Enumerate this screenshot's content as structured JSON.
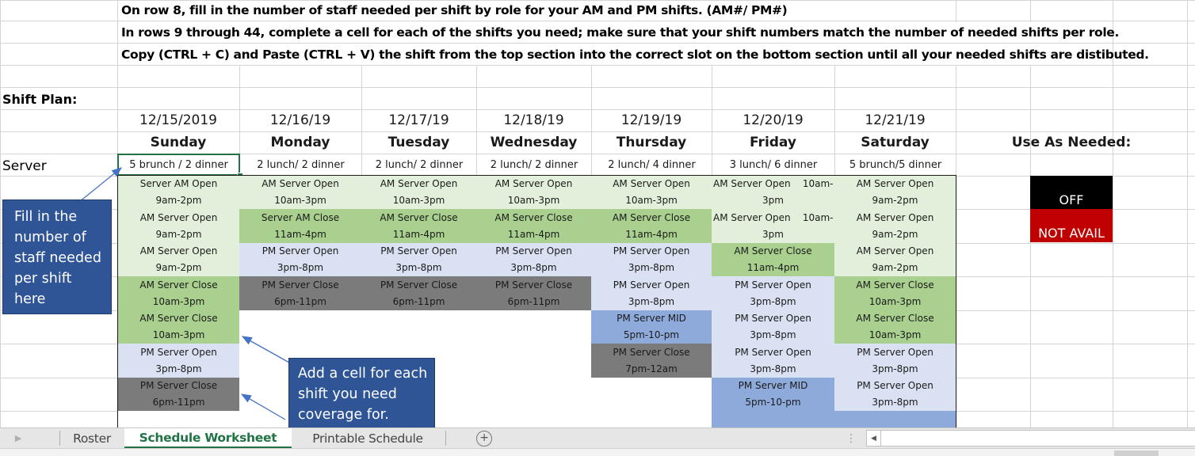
{
  "instructions": [
    "On row 8, fill in the number of staff needed per shift by role for your AM and PM shifts. (AM#/ PM#)",
    "In rows 9 through 44, complete a cell for each of the shifts you need; make sure that your shift numbers match the number of needed shifts per role.",
    "Copy (CTRL + C) and Paste (CTRL + V) the shift from the top section into the correct slot on the bottom section until all your needed shifts are distibuted."
  ],
  "shift_plan_label": "Shift Plan:",
  "role_label": "Server",
  "use_as_needed_label": "Use As Needed:",
  "colors": {
    "am_open": "#e2efda",
    "am_close": "#a9d08e",
    "pm_open": "#d9e1f2",
    "pm_mid": "#8eaadb",
    "pm_close": "#7b7b7b",
    "off": "#000000",
    "not_avail": "#c00000",
    "callout": "#2f5597",
    "active_tab": "#217346"
  },
  "days": [
    {
      "date": "12/15/2019",
      "day": "Sunday",
      "needed": "5 brunch / 2 dinner",
      "shifts": [
        {
          "name": "Server AM Open",
          "time": "9am-2pm",
          "type": "am_open"
        },
        {
          "name": "AM Server Open",
          "time": "9am-2pm",
          "type": "am_open"
        },
        {
          "name": "AM Server Open",
          "time": "9am-2pm",
          "type": "am_open"
        },
        {
          "name": "AM Server Close",
          "time": "10am-3pm",
          "type": "am_close"
        },
        {
          "name": "AM Server Close",
          "time": "10am-3pm",
          "type": "am_close"
        },
        {
          "name": "PM Server Open",
          "time": "3pm-8pm",
          "type": "pm_open"
        },
        {
          "name": "PM Server Close",
          "time": "6pm-11pm",
          "type": "pm_close"
        }
      ]
    },
    {
      "date": "12/16/19",
      "day": "Monday",
      "needed": "2 lunch/ 2 dinner",
      "shifts": [
        {
          "name": "AM Server Open",
          "time": "10am-3pm",
          "type": "am_open"
        },
        {
          "name": "Server AM Close",
          "time": "11am-4pm",
          "type": "am_close"
        },
        {
          "name": "PM Server Open",
          "time": "3pm-8pm",
          "type": "pm_open"
        },
        {
          "name": "PM Server Close",
          "time": "6pm-11pm",
          "type": "pm_close"
        }
      ]
    },
    {
      "date": "12/17/19",
      "day": "Tuesday",
      "needed": "2 lunch/ 2 dinner",
      "shifts": [
        {
          "name": "AM Server Open",
          "time": "10am-3pm",
          "type": "am_open"
        },
        {
          "name": "AM Server Close",
          "time": "11am-4pm",
          "type": "am_close"
        },
        {
          "name": "PM Server Open",
          "time": "3pm-8pm",
          "type": "pm_open"
        },
        {
          "name": "PM Server Close",
          "time": "6pm-11pm",
          "type": "pm_close"
        }
      ]
    },
    {
      "date": "12/18/19",
      "day": "Wednesday",
      "needed": "2 lunch/ 2 dinner",
      "shifts": [
        {
          "name": "AM Server Open",
          "time": "10am-3pm",
          "type": "am_open"
        },
        {
          "name": "AM Server Close",
          "time": "11am-4pm",
          "type": "am_close"
        },
        {
          "name": "PM Server Open",
          "time": "3pm-8pm",
          "type": "pm_open"
        },
        {
          "name": "PM Server Close",
          "time": "6pm-11pm",
          "type": "pm_close"
        }
      ]
    },
    {
      "date": "12/19/19",
      "day": "Thursday",
      "needed": "2 lunch/ 4 dinner",
      "shifts": [
        {
          "name": "AM Server Open",
          "time": "10am-3pm",
          "type": "am_open"
        },
        {
          "name": "AM Server Close",
          "time": "11am-4pm",
          "type": "am_close"
        },
        {
          "name": "PM Server Open",
          "time": "3pm-8pm",
          "type": "pm_open"
        },
        {
          "name": "PM Server Open",
          "time": "3pm-8pm",
          "type": "pm_open"
        },
        {
          "name": "PM Server MID",
          "time": "5pm-10-pm",
          "type": "pm_mid"
        },
        {
          "name": "PM Server Close",
          "time": "7pm-12am",
          "type": "pm_close"
        }
      ]
    },
    {
      "date": "12/20/19",
      "day": "Friday",
      "needed": "3 lunch/ 6 dinner",
      "shifts": [
        {
          "name": "AM Server Open    10am-",
          "time": "3pm",
          "type": "am_open"
        },
        {
          "name": "AM Server Open    10am-",
          "time": "3pm",
          "type": "am_open"
        },
        {
          "name": "AM Server Close",
          "time": "11am-4pm",
          "type": "am_close"
        },
        {
          "name": "PM Server Open",
          "time": "3pm-8pm",
          "type": "pm_open"
        },
        {
          "name": "PM Server Open",
          "time": "3pm-8pm",
          "type": "pm_open"
        },
        {
          "name": "PM Server Open",
          "time": "3pm-8pm",
          "type": "pm_open"
        },
        {
          "name": "PM Server MID",
          "time": "5pm-10-pm",
          "type": "pm_mid"
        },
        {
          "name": "",
          "time": "",
          "type": "pm_mid"
        }
      ]
    },
    {
      "date": "12/21/19",
      "day": "Saturday",
      "needed": "5 brunch/5 dinner",
      "shifts": [
        {
          "name": "AM Server Open",
          "time": "9am-2pm",
          "type": "am_open"
        },
        {
          "name": "AM Server Open",
          "time": "9am-2pm",
          "type": "am_open"
        },
        {
          "name": "AM Server Open",
          "time": "9am-2pm",
          "type": "am_open"
        },
        {
          "name": "AM Server Close",
          "time": "10am-3pm",
          "type": "am_close"
        },
        {
          "name": "AM Server Close",
          "time": "10am-3pm",
          "type": "am_close"
        },
        {
          "name": "PM Server Open",
          "time": "3pm-8pm",
          "type": "pm_open"
        },
        {
          "name": "PM Server Open",
          "time": "3pm-8pm",
          "type": "pm_open"
        },
        {
          "name": "",
          "time": "",
          "type": "pm_mid"
        }
      ]
    }
  ],
  "use_as_needed": [
    {
      "label": "OFF",
      "type": "off"
    },
    {
      "label": "NOT AVAIL",
      "type": "not_avail"
    }
  ],
  "callouts": {
    "fill_in": "Fill in the number of staff needed per shift here",
    "add_cell": "Add a cell for each shift you need coverage for."
  },
  "tabs": [
    {
      "label": "Roster",
      "active": false
    },
    {
      "label": "Schedule Worksheet",
      "active": true
    },
    {
      "label": "Printable Schedule",
      "active": false
    }
  ],
  "add_sheet_icon": "plus-circle-icon",
  "scroll_left_icon": "caret-left-icon"
}
